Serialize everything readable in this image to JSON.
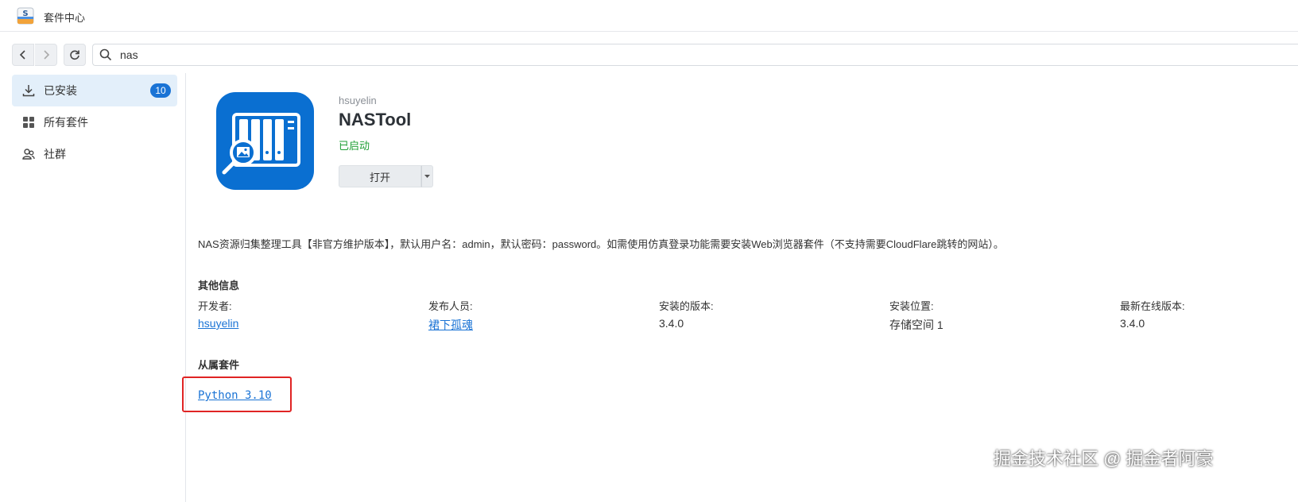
{
  "window": {
    "title": "套件中心",
    "icon": "package-center-icon"
  },
  "toolbar": {
    "search_value": "nas"
  },
  "sidebar": {
    "items": [
      {
        "label": "已安装",
        "icon": "download-icon",
        "badge": "10",
        "active": true
      },
      {
        "label": "所有套件",
        "icon": "grid-icon"
      },
      {
        "label": "社群",
        "icon": "community-icon"
      }
    ]
  },
  "package": {
    "developer": "hsuyelin",
    "name": "NASTool",
    "status": "已启动",
    "status_color": "#1e9e35",
    "open_label": "打开",
    "icon_bg": "#0a6fd1",
    "description": "NAS资源归集整理工具【非官方维护版本】，默认用户名：admin，默认密码：password。如需使用仿真登录功能需要安装Web浏览器套件（不支持需要CloudFlare跳转的网站）。"
  },
  "other_info": {
    "title": "其他信息",
    "fields": [
      {
        "label": "开发者:",
        "value": "hsuyelin",
        "link": true
      },
      {
        "label": "发布人员:",
        "value": "裙下孤魂",
        "link": true
      },
      {
        "label": "安装的版本:",
        "value": "3.4.0"
      },
      {
        "label": "安装位置:",
        "value": "存储空间 1"
      },
      {
        "label": "最新在线版本:",
        "value": "3.4.0"
      }
    ]
  },
  "dependencies": {
    "title": "从属套件",
    "items": [
      "Python 3.10"
    ]
  },
  "watermark": "掘金技术社区 @ 掘金者阿豪",
  "colors": {
    "accent": "#1a73d5",
    "highlight_box": "#e02424",
    "sidebar_active": "#e3effa"
  }
}
